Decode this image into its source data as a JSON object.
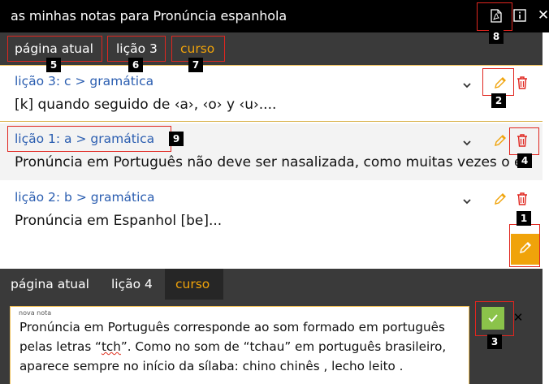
{
  "title_bar": {
    "title": "as minhas notas para Pronúncia espanhola",
    "icons": [
      "pdf-icon",
      "info-icon",
      "close-icon"
    ]
  },
  "top_tabs": [
    {
      "label": "página atual",
      "active": false
    },
    {
      "label": "lição 3",
      "active": false
    },
    {
      "label": "curso",
      "active": true
    }
  ],
  "notes": [
    {
      "title": "lição 3: c > gramática",
      "body": "[k] quando seguido de ‹a›, ‹o› y ‹u›...."
    },
    {
      "title": "lição 1: a > gramática",
      "body": "Pronúncia em Português não deve ser nasalizada, como muitas vezes o é."
    },
    {
      "title": "lição 2: b > gramática",
      "body": "Pronúncia em Espanhol [be]..."
    }
  ],
  "bottom_tabs": [
    {
      "label": "página atual",
      "active": false
    },
    {
      "label": "lição 4",
      "active": false
    },
    {
      "label": "curso",
      "active": true
    }
  ],
  "editor": {
    "label": "nova nota",
    "text_before": "Pronúncia em Português corresponde ao som formado em português pelas letras “",
    "text_misspelled": "tch",
    "text_after": "”. Como no som de “tchau” em português brasileiro, aparece sempre no início da sílaba: chino chinês , lecho leito ."
  },
  "markers": [
    "1",
    "2",
    "3",
    "4",
    "5",
    "6",
    "7",
    "8",
    "9"
  ],
  "colors": {
    "accent": "#f0a30a",
    "link": "#2a5db0",
    "delete": "#e0261f",
    "confirm": "#8bc34a",
    "bar": "#3a3a3a",
    "highlight": "#e0261f"
  }
}
